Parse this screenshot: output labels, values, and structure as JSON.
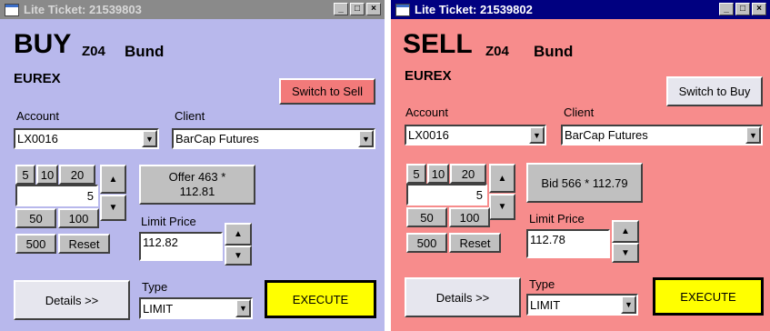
{
  "buy": {
    "title": "Lite Ticket: 21539803",
    "side": "BUY",
    "contract": "Z04",
    "product": "Bund",
    "exchange": "EUREX",
    "switch_label": "Switch to Sell",
    "account_label": "Account",
    "account_value": "LX0016",
    "client_label": "Client",
    "client_value": "BarCap Futures",
    "qty_buttons": [
      "5",
      "10",
      "20",
      "50",
      "100",
      "500",
      "Reset"
    ],
    "quantity": "5",
    "price_button_line1": "Offer 463  *",
    "price_button_line2": "112.81",
    "limit_label": "Limit Price",
    "limit_value": "112.82",
    "details_label": "Details >>",
    "type_label": "Type",
    "type_value": "LIMIT",
    "execute_label": "EXECUTE",
    "bg_color": "#b8b8ec"
  },
  "sell": {
    "title": "Lite Ticket: 21539802",
    "side": "SELL",
    "contract": "Z04",
    "product": "Bund",
    "exchange": "EUREX",
    "switch_label": "Switch to Buy",
    "account_label": "Account",
    "account_value": "LX0016",
    "client_label": "Client",
    "client_value": "BarCap Futures",
    "qty_buttons": [
      "5",
      "10",
      "20",
      "50",
      "100",
      "500",
      "Reset"
    ],
    "quantity": "5",
    "price_button_line1": "Bid 566  *  112.79",
    "limit_label": "Limit Price",
    "limit_value": "112.78",
    "details_label": "Details >>",
    "type_label": "Type",
    "type_value": "LIMIT",
    "execute_label": "EXECUTE",
    "bg_color": "#f78c8c"
  },
  "icons": {
    "minimize": "minimize-icon",
    "maximize": "maximize-icon",
    "close": "close-icon",
    "dropdown": "chevron-down-icon",
    "spin_up": "triangle-up-icon",
    "spin_down": "triangle-down-icon"
  }
}
